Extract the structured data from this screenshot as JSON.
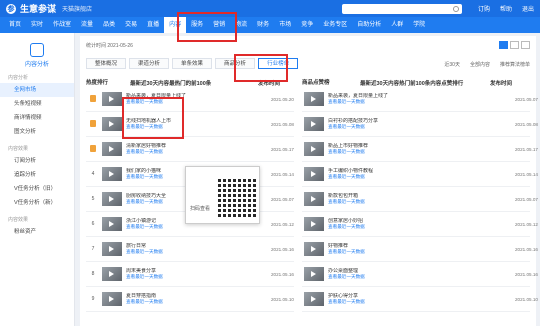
{
  "header": {
    "brand": "生意参谋",
    "shop": "天猫旗舰店",
    "right_links": [
      "订购",
      "帮助",
      "退出"
    ]
  },
  "nav": {
    "items": [
      "首页",
      "实时",
      "作战室",
      "流量",
      "品类",
      "交易",
      "直播",
      "内容",
      "服务",
      "营销",
      "物流",
      "财务",
      "市场",
      "竞争",
      "业务专区",
      "自助分析",
      "人群",
      "学院"
    ],
    "active": "内容"
  },
  "sidebar": {
    "header": "内容分析",
    "groups": [
      {
        "title": "内容分析",
        "items": [
          "全网市场",
          "头条短视频",
          "商详情视频"
        ],
        "active": "全网市场"
      },
      {
        "title": "",
        "items": [
          "图文分析"
        ]
      },
      {
        "title": "内容效果",
        "items": [
          "订阅分析",
          "追踪分析",
          "V任务分析（旧）",
          "V任务分析（新）"
        ]
      },
      {
        "title": "内容效果",
        "items": [
          "粉丝资产"
        ]
      }
    ]
  },
  "main": {
    "date_text": "统计时间 2021-05-26",
    "tabs": [
      "整体概况",
      "渠道分析",
      "单条效果",
      "商品分析",
      "行业榜单"
    ],
    "active_tab": "行业榜单",
    "filters": [
      "近30天",
      "全部内容",
      "推荐算法榜单"
    ],
    "left_col": {
      "rank_header": "热度排行",
      "content_header": "最新近30天内容最热门的前100条",
      "date_header": "发布时间"
    },
    "right_col": {
      "content_header": "商品点赞榜",
      "sub_header": "最新近30天内容热门前100条内容点赞排行",
      "date_header": "发布时间"
    },
    "link_text": "查看最近一天数据",
    "left_rows": [
      {
        "rank": "1",
        "title": "新品来袭，夏日限量上线了",
        "date": "2021.05.20",
        "medal": true
      },
      {
        "rank": "2",
        "title": "无线扫地机器人上市",
        "date": "2021.05.08",
        "medal": true
      },
      {
        "rank": "3",
        "title": "清新家居好物推荐",
        "date": "2021.05.17",
        "medal": true
      },
      {
        "rank": "4",
        "title": "我们家的小猫咪",
        "date": "2021.05.14",
        "medal": false
      },
      {
        "rank": "5",
        "title": "厨房收纳技巧大全",
        "date": "2021.05.07",
        "medal": false
      },
      {
        "rank": "6",
        "title": "浙江小镇游记",
        "date": "2021.05.12",
        "medal": false
      },
      {
        "rank": "7",
        "title": "旅行日常",
        "date": "2021.05.16",
        "medal": false
      },
      {
        "rank": "8",
        "title": "周末美食分享",
        "date": "2021.05.16",
        "medal": false
      },
      {
        "rank": "9",
        "title": "夏日穿搭指南",
        "date": "2021.05.10",
        "medal": false
      }
    ],
    "right_rows": [
      {
        "title": "新品来袭，夏日限量上线了",
        "date": "2021.05.07",
        "medal": true
      },
      {
        "title": "白衬衫的搭配技巧分享",
        "date": "2021.05.08",
        "medal": true
      },
      {
        "title": "新品上市好物推荐",
        "date": "2021.05.17",
        "medal": true
      },
      {
        "title": "手工编织小物件教程",
        "date": "2021.05.14",
        "medal": false
      },
      {
        "title": "新款包包开箱",
        "date": "2021.05.07",
        "medal": false
      },
      {
        "title": "创意家居小妙招",
        "date": "2021.05.12",
        "medal": false
      },
      {
        "title": "好物推荐",
        "date": "2021.05.16",
        "medal": false
      },
      {
        "title": "办公桌面整理",
        "date": "2021.05.16",
        "medal": false
      },
      {
        "title": "护肤心得分享",
        "date": "2021.05.10",
        "medal": false
      }
    ],
    "popup_text": "扫码查看"
  }
}
